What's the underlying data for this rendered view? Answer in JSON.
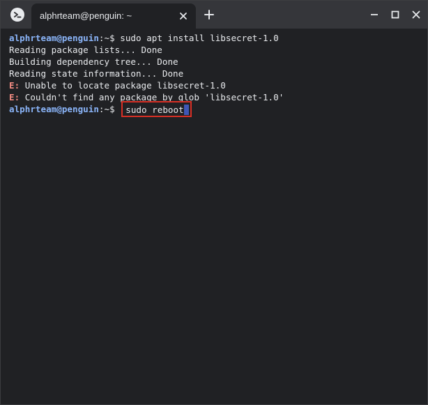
{
  "titlebar": {
    "app_icon": "terminal-icon",
    "tab_title": "alphrteam@penguin: ~",
    "tab_close_icon": "close-icon",
    "new_tab_icon": "plus-icon",
    "minimize_icon": "minimize-icon",
    "maximize_icon": "maximize-icon",
    "close_icon": "close-icon"
  },
  "terminal": {
    "prompt_user": "alphrteam@penguin",
    "prompt_suffix": ":~$ ",
    "lines": [
      {
        "type": "prompt",
        "command": "sudo apt install libsecret-1.0"
      },
      {
        "type": "text",
        "text": "Reading package lists... Done"
      },
      {
        "type": "text",
        "text": "Building dependency tree... Done"
      },
      {
        "type": "text",
        "text": "Reading state information... Done"
      },
      {
        "type": "error",
        "tag": "E:",
        "text": " Unable to locate package libsecret-1.0"
      },
      {
        "type": "error",
        "tag": "E:",
        "text": " Couldn't find any package by glob 'libsecret-1.0'"
      },
      {
        "type": "prompt",
        "command": "sudo reboot",
        "highlighted": true
      }
    ]
  },
  "colors": {
    "background": "#202124",
    "titlebar": "#35363a",
    "prompt_user": "#8ab4f8",
    "error_tag": "#f28b82",
    "highlight_box": "#d93025",
    "cursor": "#3f57b5"
  }
}
